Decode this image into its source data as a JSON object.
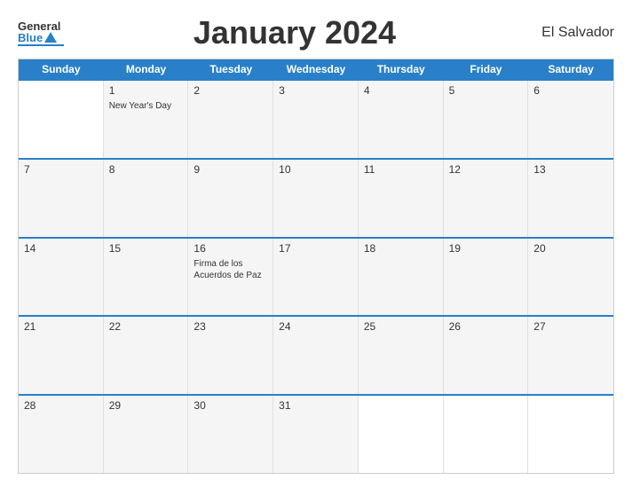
{
  "header": {
    "logo_general": "General",
    "logo_blue": "Blue",
    "title": "January 2024",
    "country": "El Salvador"
  },
  "days_of_week": [
    "Sunday",
    "Monday",
    "Tuesday",
    "Wednesday",
    "Thursday",
    "Friday",
    "Saturday"
  ],
  "weeks": [
    [
      {
        "num": "",
        "empty": true
      },
      {
        "num": "1",
        "event": "New Year's Day"
      },
      {
        "num": "2",
        "event": ""
      },
      {
        "num": "3",
        "event": ""
      },
      {
        "num": "4",
        "event": ""
      },
      {
        "num": "5",
        "event": ""
      },
      {
        "num": "6",
        "event": ""
      }
    ],
    [
      {
        "num": "7",
        "event": ""
      },
      {
        "num": "8",
        "event": ""
      },
      {
        "num": "9",
        "event": ""
      },
      {
        "num": "10",
        "event": ""
      },
      {
        "num": "11",
        "event": ""
      },
      {
        "num": "12",
        "event": ""
      },
      {
        "num": "13",
        "event": ""
      }
    ],
    [
      {
        "num": "14",
        "event": ""
      },
      {
        "num": "15",
        "event": ""
      },
      {
        "num": "16",
        "event": "Firma de los Acuerdos de Paz"
      },
      {
        "num": "17",
        "event": ""
      },
      {
        "num": "18",
        "event": ""
      },
      {
        "num": "19",
        "event": ""
      },
      {
        "num": "20",
        "event": ""
      }
    ],
    [
      {
        "num": "21",
        "event": ""
      },
      {
        "num": "22",
        "event": ""
      },
      {
        "num": "23",
        "event": ""
      },
      {
        "num": "24",
        "event": ""
      },
      {
        "num": "25",
        "event": ""
      },
      {
        "num": "26",
        "event": ""
      },
      {
        "num": "27",
        "event": ""
      }
    ],
    [
      {
        "num": "28",
        "event": ""
      },
      {
        "num": "29",
        "event": ""
      },
      {
        "num": "30",
        "event": ""
      },
      {
        "num": "31",
        "event": ""
      },
      {
        "num": "",
        "empty": true
      },
      {
        "num": "",
        "empty": true
      },
      {
        "num": "",
        "empty": true
      }
    ]
  ]
}
